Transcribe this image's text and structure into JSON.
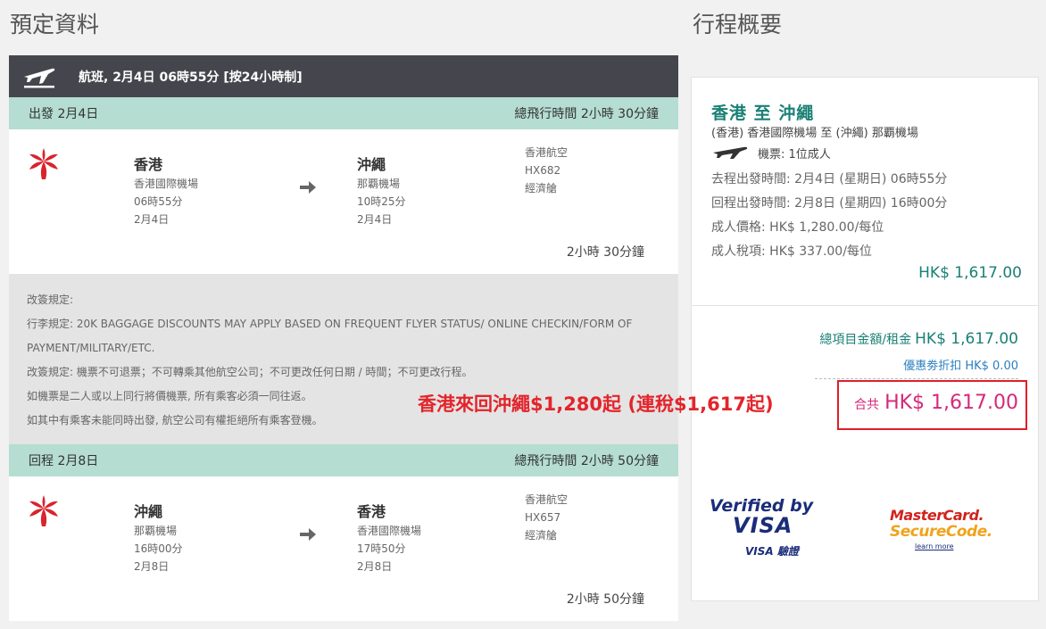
{
  "titles": {
    "booking": "預定資料",
    "summary": "行程概要"
  },
  "flight_bar": {
    "label": "航班, 2月4日 06時55分 [按24小時制]"
  },
  "outbound": {
    "header_left": "出發 2月4日",
    "header_right": "總飛行時間 2小時 30分鐘",
    "origin": {
      "city": "香港",
      "airport": "香港國際機場",
      "time": "06時55分",
      "date": "2月4日"
    },
    "destination": {
      "city": "沖繩",
      "airport": "那覇機場",
      "time": "10時25分",
      "date": "2月4日"
    },
    "airline": "香港航空",
    "flight_no": "HX682",
    "cabin": "經濟艙",
    "duration": "2小時 30分鐘"
  },
  "rules": [
    "改簽規定:",
    "行李規定: 20K BAGGAGE DISCOUNTS MAY APPLY BASED ON FREQUENT FLYER STATUS/ ONLINE CHECKIN/FORM OF",
    "PAYMENT/MILITARY/ETC.",
    "改簽規定: 機票不可退票；不可轉乘其他航空公司；不可更改任何日期 / 時間；不可更改行程。",
    "如機票是二人或以上同行將價機票, 所有乘客必須一同往返。",
    "如其中有乘客未能同時出發, 航空公司有權拒絕所有乘客登機。"
  ],
  "return": {
    "header_left": "回程 2月8日",
    "header_right": "總飛行時間 2小時 50分鐘",
    "origin": {
      "city": "沖繩",
      "airport": "那覇機場",
      "time": "16時00分",
      "date": "2月8日"
    },
    "destination": {
      "city": "香港",
      "airport": "香港國際機場",
      "time": "17時50分",
      "date": "2月8日"
    },
    "airline": "香港航空",
    "flight_no": "HX657",
    "cabin": "經濟艙",
    "duration": "2小時 50分鐘"
  },
  "summary": {
    "route": "香港 至 沖繩",
    "route_detail": "(香港) 香港國際機場  至  (沖繩) 那覇機場",
    "ticket": "機票: 1位成人",
    "depart_line": "去程出發時間: 2月4日 (星期日) 06時55分",
    "return_line": "回程出發時間: 2月8日 (星期四) 16時00分",
    "adult_price": "成人價格: HK$ 1,280.00/每位",
    "adult_tax": "成人稅項: HK$ 337.00/每位",
    "price": "HK$ 1,617.00",
    "total_label": "總項目金額/租金",
    "total_amount": "HK$ 1,617.00",
    "coupon": "優惠劵折扣 HK$ 0.00",
    "grand_label": "合共",
    "grand_amount": "HK$ 1,617.00"
  },
  "overlay_text": "香港來回沖繩$1,280起 (連稅$1,617起)",
  "badges": {
    "visa_line1": "Verified by",
    "visa_line2": "VISA",
    "visa_line3": "VISA 驗證",
    "mc_line1": "MasterCard.",
    "mc_line2": "SecureCode.",
    "mc_learn": "learn more"
  },
  "colors": {
    "teal": "#1a8075",
    "mint": "#b5ddd2",
    "dark_bar": "#45464d",
    "grand_pink": "#d6287a",
    "promo_red": "#e3242b"
  }
}
